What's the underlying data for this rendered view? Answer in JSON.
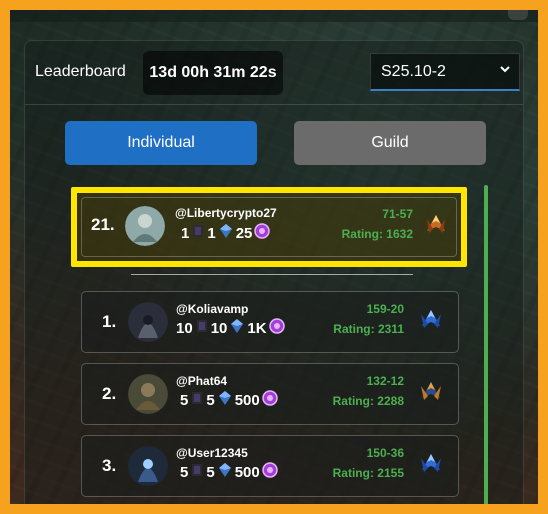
{
  "header": {
    "title": "Leaderboard",
    "timer": "13d 00h 31m 22s",
    "season": "S25.10-2"
  },
  "tabs": [
    {
      "label": "Individual",
      "active": true
    },
    {
      "label": "Guild",
      "active": false
    }
  ],
  "current_user": {
    "rank": "21.",
    "handle": "@Libertycrypto27",
    "stat1": "1",
    "stat2": "1",
    "stat3": "25",
    "record": "71-57",
    "rating": "Rating: 1632"
  },
  "players": [
    {
      "rank": "1.",
      "handle": "@Koliavamp",
      "stat1": "10",
      "stat2": "10",
      "stat3": "1K",
      "record": "159-20",
      "rating": "Rating: 2311"
    },
    {
      "rank": "2.",
      "handle": "@Phat64",
      "stat1": "5",
      "stat2": "5",
      "stat3": "500",
      "record": "132-12",
      "rating": "Rating: 2288"
    },
    {
      "rank": "3.",
      "handle": "@User12345",
      "stat1": "5",
      "stat2": "5",
      "stat3": "500",
      "record": "150-36",
      "rating": "Rating: 2155"
    }
  ],
  "colors": {
    "highlight_border": "#ffe600",
    "accent_green": "#4caf50",
    "tab_active": "#1f6fc4",
    "tab_inactive": "#6b6b6b",
    "outer_border": "#f7a21e"
  },
  "icons": [
    "card-pack-icon",
    "gem-stack-icon",
    "purple-coin-icon",
    "rank-badge-icon",
    "chevron-down-icon"
  ]
}
